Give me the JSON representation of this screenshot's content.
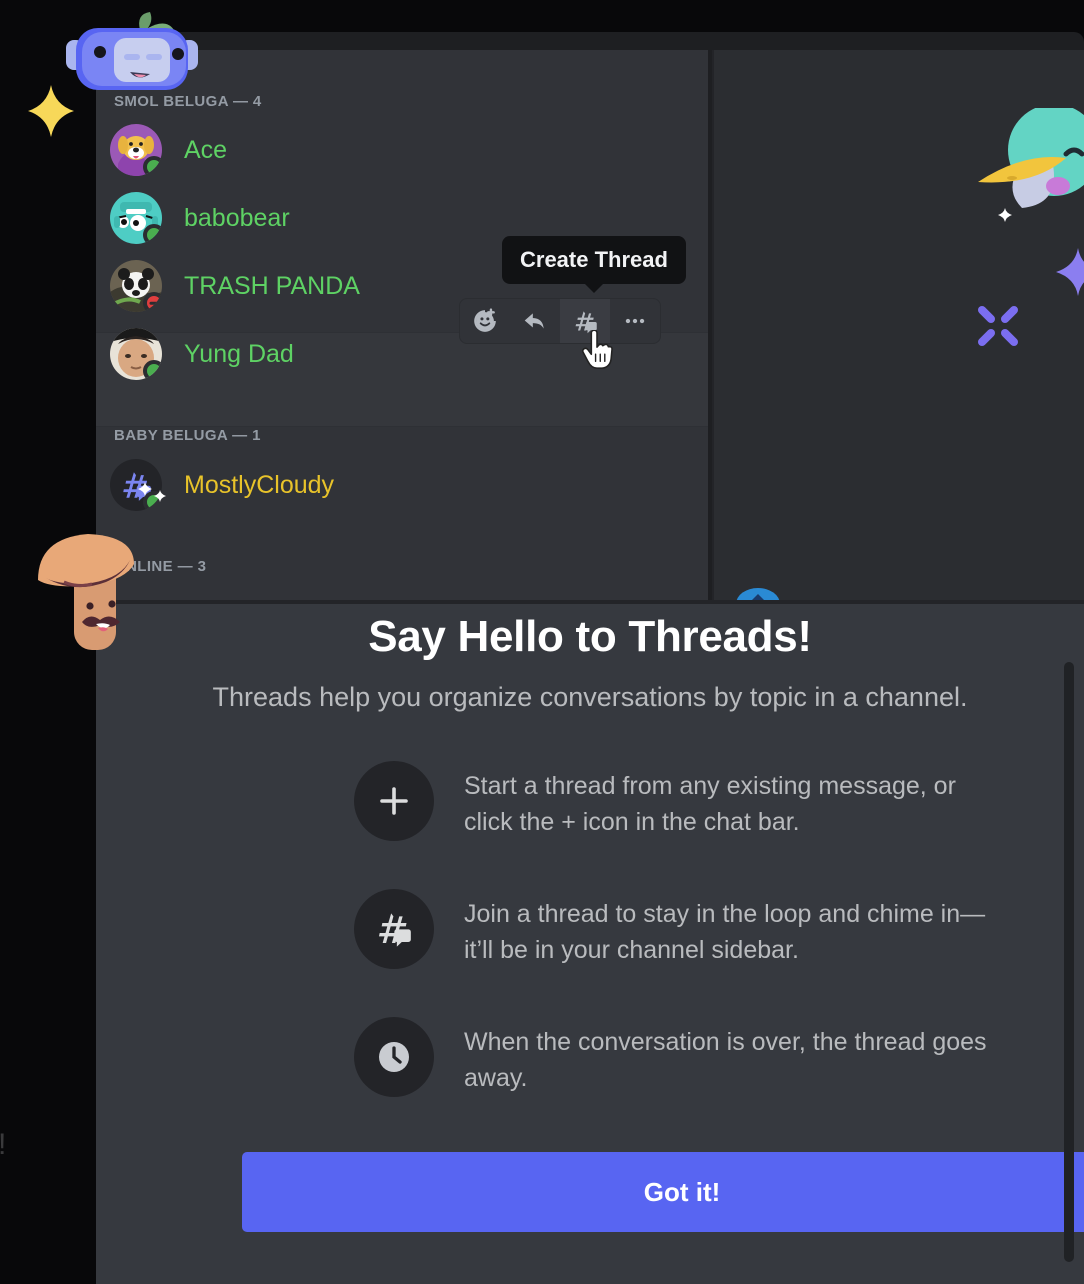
{
  "member_list": {
    "groups": [
      {
        "title": "SMOL BELUGA — 4",
        "members": [
          {
            "name": "Ace",
            "color": "#5ed264",
            "status": "online",
            "avatar": "dog-avatar"
          },
          {
            "name": "babobear",
            "color": "#5ed264",
            "status": "online",
            "avatar": "robot-avatar"
          },
          {
            "name": "TRASH PANDA",
            "color": "#5ed264",
            "status": "dnd",
            "avatar": "panda-avatar"
          },
          {
            "name": "Yung Dad",
            "color": "#5ed264",
            "status": "online",
            "avatar": "baby-avatar"
          }
        ]
      },
      {
        "title": "BABY BELUGA — 1",
        "members": [
          {
            "name": "MostlyCloudy",
            "color": "#e8c32a",
            "status": "online",
            "avatar": "thread-avatar"
          }
        ]
      },
      {
        "title": "ONLINE — 3",
        "members": []
      }
    ]
  },
  "message_toolbar": {
    "tooltip": "Create Thread",
    "buttons": [
      {
        "name": "add-reaction-icon",
        "label": "Add Reaction"
      },
      {
        "name": "reply-icon",
        "label": "Reply"
      },
      {
        "name": "create-thread-icon",
        "label": "Create Thread"
      },
      {
        "name": "more-icon",
        "label": "More"
      }
    ]
  },
  "modal": {
    "title": "Say Hello to Threads!",
    "subtitle": "Threads help you organize conversations by topic in a channel.",
    "features": [
      {
        "icon": "plus-icon",
        "text": "Start a thread from any existing message, or click the + icon in the chat bar."
      },
      {
        "icon": "thread-icon",
        "text": "Join a thread to stay in the loop and chime in—it’ll be in your channel sidebar."
      },
      {
        "icon": "clock-icon",
        "text": "When the conversation is over, the thread goes away."
      }
    ],
    "confirm_label": "Got it!",
    "accent_color": "#5865f2"
  },
  "decorations": {
    "faint_text": ")!",
    "mascots": [
      "wumpus-robot-mascot",
      "mushroom-mascot",
      "bird-mascot"
    ],
    "sparkles": [
      "yellow-star-sparkle",
      "purple-star-sparkle",
      "purple-x-sparkle",
      "white-sparkle"
    ]
  }
}
